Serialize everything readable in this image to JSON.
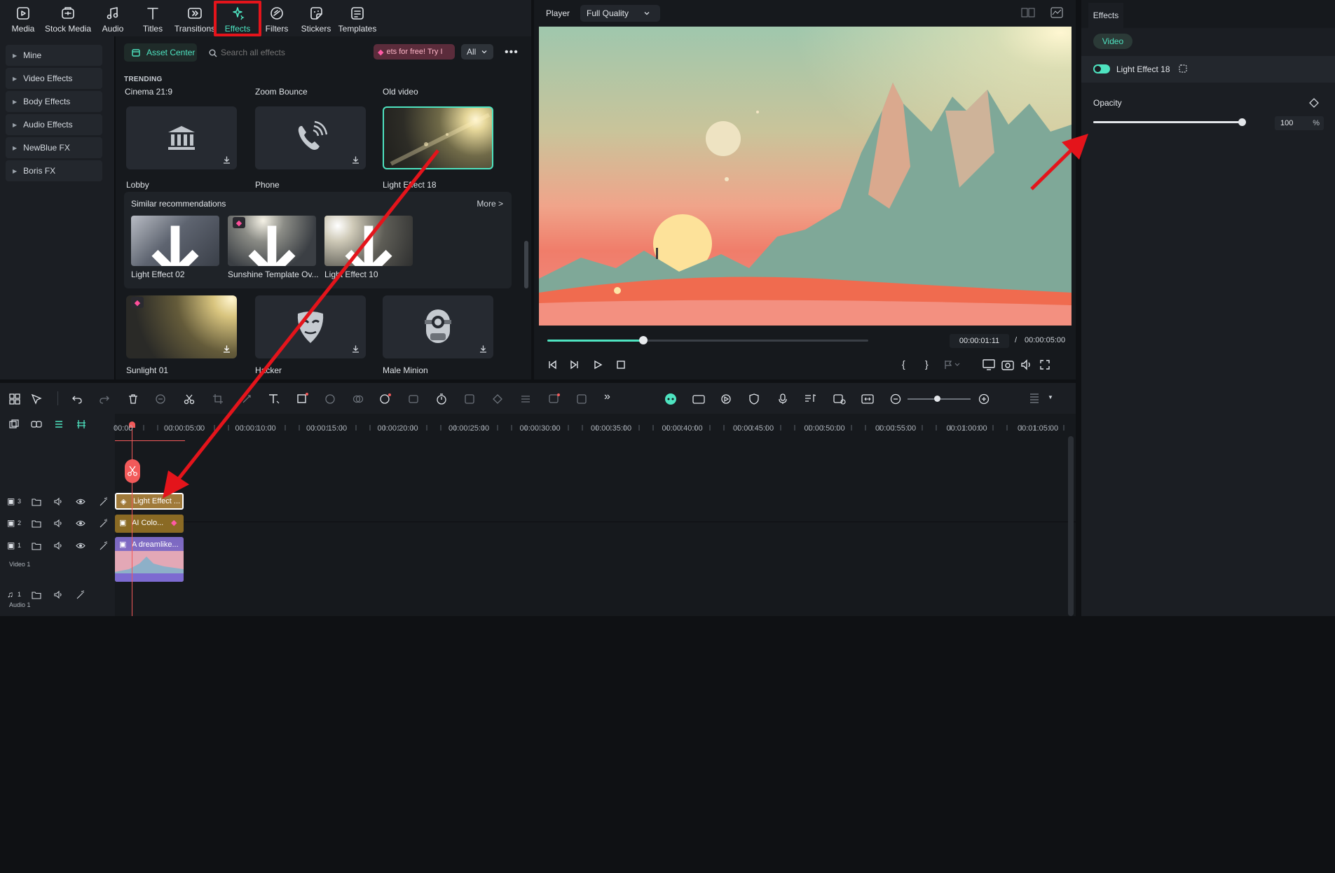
{
  "toolbar": {
    "tabs": [
      {
        "label": "Media",
        "icon": "media-icon"
      },
      {
        "label": "Stock Media",
        "icon": "stock-media-icon"
      },
      {
        "label": "Audio",
        "icon": "audio-icon"
      },
      {
        "label": "Titles",
        "icon": "titles-icon"
      },
      {
        "label": "Transitions",
        "icon": "transitions-icon"
      },
      {
        "label": "Effects",
        "icon": "effects-icon"
      },
      {
        "label": "Filters",
        "icon": "filters-icon"
      },
      {
        "label": "Stickers",
        "icon": "stickers-icon"
      },
      {
        "label": "Templates",
        "icon": "templates-icon"
      }
    ],
    "active": "Effects"
  },
  "categories": [
    "Mine",
    "Video Effects",
    "Body Effects",
    "Audio Effects",
    "NewBlue FX",
    "Boris FX"
  ],
  "library": {
    "asset_center": "Asset Center",
    "search_placeholder": "Search all effects",
    "promo": "ets for free! Try I",
    "filter": "All",
    "trending_label": "TRENDING",
    "row0_titles": [
      "Cinema 21:9",
      "Zoom Bounce",
      "Old video"
    ],
    "row1": [
      {
        "title": "Lobby",
        "icon": "bank-icon"
      },
      {
        "title": "Phone",
        "icon": "phone-icon"
      },
      {
        "title": "Light Effect 18",
        "icon": "light-leak-thumb"
      }
    ],
    "similar": {
      "label": "Similar recommendations",
      "more": "More >",
      "items": [
        "Light Effect 02",
        "Sunshine Template Ov...",
        "Light Effect 10"
      ]
    },
    "row2": [
      {
        "title": "Sunlight 01",
        "icon": "sunlight-thumb"
      },
      {
        "title": "Hacker",
        "icon": "mask-icon"
      },
      {
        "title": "Male Minion",
        "icon": "minion-icon"
      }
    ]
  },
  "player": {
    "label": "Player",
    "quality": "Full Quality",
    "current_time": "00:00:01:11",
    "separator": "/",
    "total_time": "00:00:05:00",
    "progress": 0.3
  },
  "effects_panel": {
    "tab": "Effects",
    "subtab": "Video",
    "effect_name": "Light Effect 18",
    "enabled": true,
    "opacity_label": "Opacity",
    "opacity_value": "100",
    "opacity_unit": "%",
    "opacity_fraction": 1.0
  },
  "timeline": {
    "ruler_labels": [
      "00:00",
      "00:00:05:00",
      "00:00:10:00",
      "00:00:15:00",
      "00:00:20:00",
      "00:00:25:00",
      "00:00:30:00",
      "00:00:35:00",
      "00:00:40:00",
      "00:00:45:00",
      "00:00:50:00",
      "00:00:55:00",
      "00:01:00:00",
      "00:01:05:00"
    ],
    "tracks": [
      {
        "num": "3",
        "name": "",
        "clip": "Light Effect ..."
      },
      {
        "num": "2",
        "name": "",
        "clip": "AI Colo..."
      },
      {
        "num": "1",
        "name": "Video 1",
        "clip": "A dreamlike..."
      },
      {
        "num": "1",
        "name": "Audio 1",
        "clip": ""
      }
    ]
  },
  "colors": {
    "accent": "#4ee3c0",
    "highlight_red": "#e4141b",
    "playhead": "#f25a5a",
    "light_clip": "#a07a3a",
    "ai_clip": "#8a6a24",
    "video_clip": "#7a68c2"
  }
}
